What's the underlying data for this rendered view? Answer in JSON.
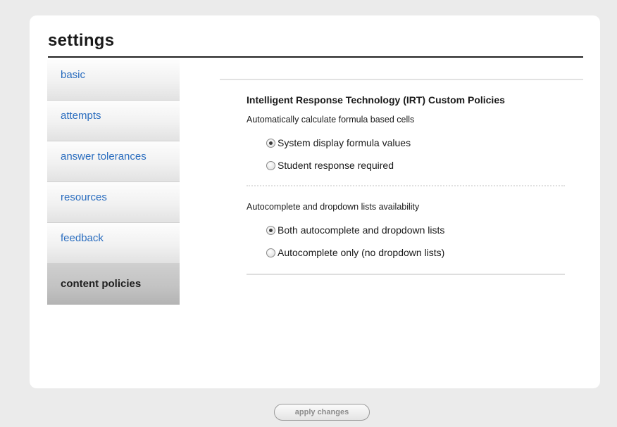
{
  "title": "settings",
  "sidebar": {
    "items": [
      {
        "label": "basic",
        "active": false
      },
      {
        "label": "attempts",
        "active": false
      },
      {
        "label": "answer tolerances",
        "active": false
      },
      {
        "label": "resources",
        "active": false
      },
      {
        "label": "feedback",
        "active": false
      },
      {
        "label": "content policies",
        "active": true
      }
    ]
  },
  "content": {
    "section_title": "Intelligent Response Technology (IRT) Custom Policies",
    "question1": {
      "label": "Automatically calculate formula based cells",
      "options": [
        {
          "label": "System display formula values",
          "checked": true
        },
        {
          "label": "Student response required",
          "checked": false
        }
      ]
    },
    "question2": {
      "label": "Autocomplete and dropdown lists availability",
      "options": [
        {
          "label": "Both autocomplete and dropdown lists",
          "checked": true
        },
        {
          "label": "Autocomplete only (no dropdown lists)",
          "checked": false
        }
      ]
    }
  },
  "footer": {
    "apply_label": "apply changes"
  },
  "colors": {
    "link": "#2a6dbf",
    "active_tab_bg": "#c2c2c2",
    "page_bg": "#ebebeb"
  }
}
